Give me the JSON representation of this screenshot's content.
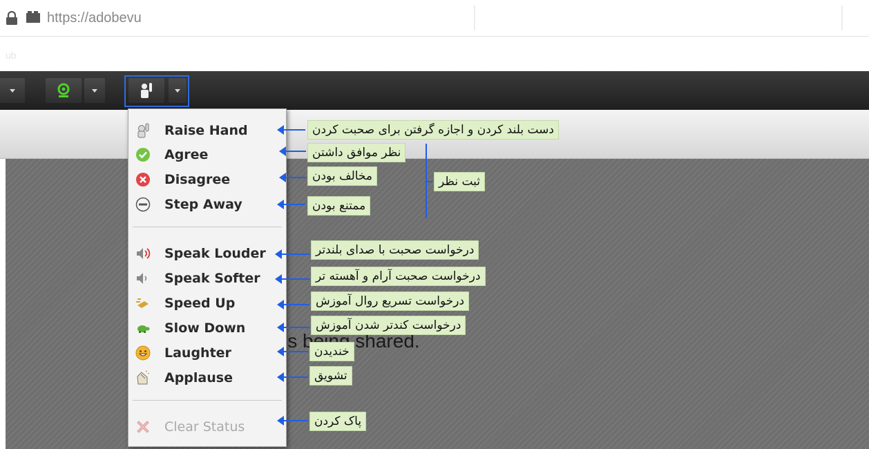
{
  "browser": {
    "url": "https://adobevu",
    "sub_text": "ub"
  },
  "content": {
    "shared_text": "is being shared."
  },
  "menu": {
    "items": [
      {
        "label": "Raise Hand",
        "icon": "raise-hand-icon"
      },
      {
        "label": "Agree",
        "icon": "agree-check-icon"
      },
      {
        "label": "Disagree",
        "icon": "disagree-x-icon"
      },
      {
        "label": "Step Away",
        "icon": "step-away-icon"
      },
      {
        "label": "Speak Louder",
        "icon": "speaker-loud-icon"
      },
      {
        "label": "Speak Softer",
        "icon": "speaker-soft-icon"
      },
      {
        "label": "Speed Up",
        "icon": "speed-up-icon"
      },
      {
        "label": "Slow Down",
        "icon": "turtle-icon"
      },
      {
        "label": "Laughter",
        "icon": "smiley-icon"
      },
      {
        "label": "Applause",
        "icon": "applause-icon"
      },
      {
        "label": "Clear Status",
        "icon": "clear-x-icon"
      }
    ]
  },
  "annotations": {
    "raise_hand": "دست بلند کردن و اجازه گرفتن برای صحبت کردن",
    "agree": "نظر موافق داشتن",
    "disagree": "مخالف بودن",
    "step_away": "ممتنع بودن",
    "vote_group": "ثبت نظر",
    "speak_louder": "درخواست صحبت با صدای بلندتر",
    "speak_softer": "درخواست صحبت آرام و آهسته تر",
    "speed_up": "درخواست تسریع روال آموزش",
    "slow_down": "درخواست کندتر شدن آموزش",
    "laughter": "خندیدن",
    "applause": "تشویق",
    "clear": "پاک کردن"
  },
  "colors": {
    "accent_blue": "#1f5fe6",
    "note_bg": "#dff0c9",
    "camera_green": "#4fd12a"
  }
}
